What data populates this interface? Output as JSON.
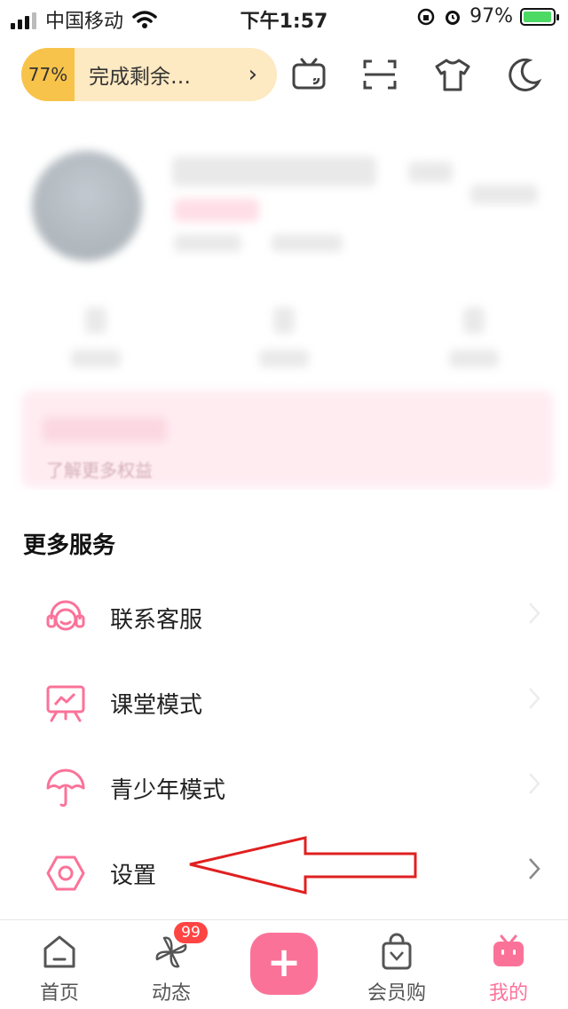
{
  "status_bar": {
    "carrier": "中国移动",
    "time": "下午1:57",
    "battery": "97%",
    "battery_level": 0.97
  },
  "toolbar": {
    "task_percent": "77%",
    "task_text": "完成剩余…",
    "icons": [
      "tv-cast-icon",
      "scan-icon",
      "outfit-icon",
      "night-mode-icon"
    ]
  },
  "profile": {
    "vip_more": "了解更多权益"
  },
  "more_services": {
    "title": "更多服务",
    "items": [
      {
        "label": "联系客服",
        "icon": "customer-service-icon"
      },
      {
        "label": "课堂模式",
        "icon": "classroom-icon"
      },
      {
        "label": "青少年模式",
        "icon": "umbrella-icon"
      },
      {
        "label": "设置",
        "icon": "settings-icon"
      }
    ]
  },
  "tabbar": {
    "home": "首页",
    "dynamic": "动态",
    "dynamic_badge": "99",
    "add": "+",
    "vip_shop": "会员购",
    "mine": "我的"
  },
  "colors": {
    "accent_pink": "#fb7299",
    "annotation_red": "#e02020",
    "task_yellow": "#f8c34a"
  }
}
